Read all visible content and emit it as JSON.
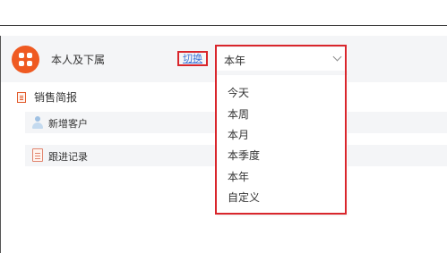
{
  "header": {
    "user_scope": "本人及下属",
    "switch_label": "切换"
  },
  "period": {
    "selected": "本年",
    "options": [
      "今天",
      "本周",
      "本月",
      "本季度",
      "本年",
      "自定义"
    ]
  },
  "section": {
    "title": "销售简报",
    "rows": [
      {
        "label": "新增客户",
        "icon": "user-icon"
      },
      {
        "label": "跟进记录",
        "icon": "document-icon"
      }
    ]
  },
  "colors": {
    "brand": "#ef5a22",
    "highlight": "#d9262c",
    "link": "#3a72d8"
  }
}
